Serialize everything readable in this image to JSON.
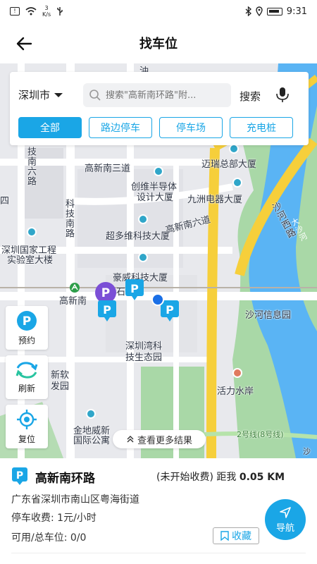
{
  "status_bar": {
    "net_speed_value": "3",
    "net_speed_unit": "K/s",
    "time": "9:31"
  },
  "header": {
    "title": "找车位"
  },
  "search": {
    "city": "深圳市",
    "placeholder": "搜索\"高新南环路\"附...",
    "button_label": "搜索"
  },
  "filter_tabs": [
    {
      "label": "全部",
      "active": true
    },
    {
      "label": "路边停车",
      "active": false
    },
    {
      "label": "停车场",
      "active": false
    },
    {
      "label": "充电桩",
      "active": false
    }
  ],
  "map": {
    "labels": {
      "n1": "沖",
      "n2": "技南六路",
      "n3": "高新南三道",
      "n4": "迈瑞总部大厦",
      "n5": "创维半导体设计大厦",
      "n5a": "创维半导体",
      "n5b": "设计大厦",
      "n6": "九洲电器大厦",
      "n7": "沙河西路",
      "n8": "大沙河",
      "n9": "四",
      "n10": "科技南路",
      "n11": "高新南六道",
      "n12": "超多维科技大厦",
      "n13a": "深圳国家工程",
      "n13b": "实验室大楼",
      "n14": "豪威科技大厦",
      "n15": "高新南",
      "n16": "石",
      "n17": "沙河信息园",
      "n18a": "深圳湾科",
      "n18b": "技生态园",
      "n19": "活力水岸",
      "n20a": "新软",
      "n20b": "发园",
      "n21a": "金地威新",
      "n21b": "国际公寓",
      "n22": "2号线(8号线)",
      "n23": "沙"
    }
  },
  "float_buttons": {
    "reserve": "预约",
    "refresh": "刷新",
    "relocate": "复位"
  },
  "more_results": "查看更多结果",
  "detail": {
    "name": "高新南环路",
    "status": "(未开始收费)",
    "distance_label": "距我",
    "distance": "0.05 KM",
    "address": "广东省深圳市南山区粤海街道",
    "fee": "停车收费: 1元/小时",
    "spaces": "可用/总车位: 0/0",
    "navigate": "导航",
    "favorite": "收藏"
  },
  "colors": {
    "accent": "#1aa6e6",
    "road_yellow": "#f6cf3b",
    "river": "#5ab4f4",
    "park": "#a7d7a6"
  }
}
